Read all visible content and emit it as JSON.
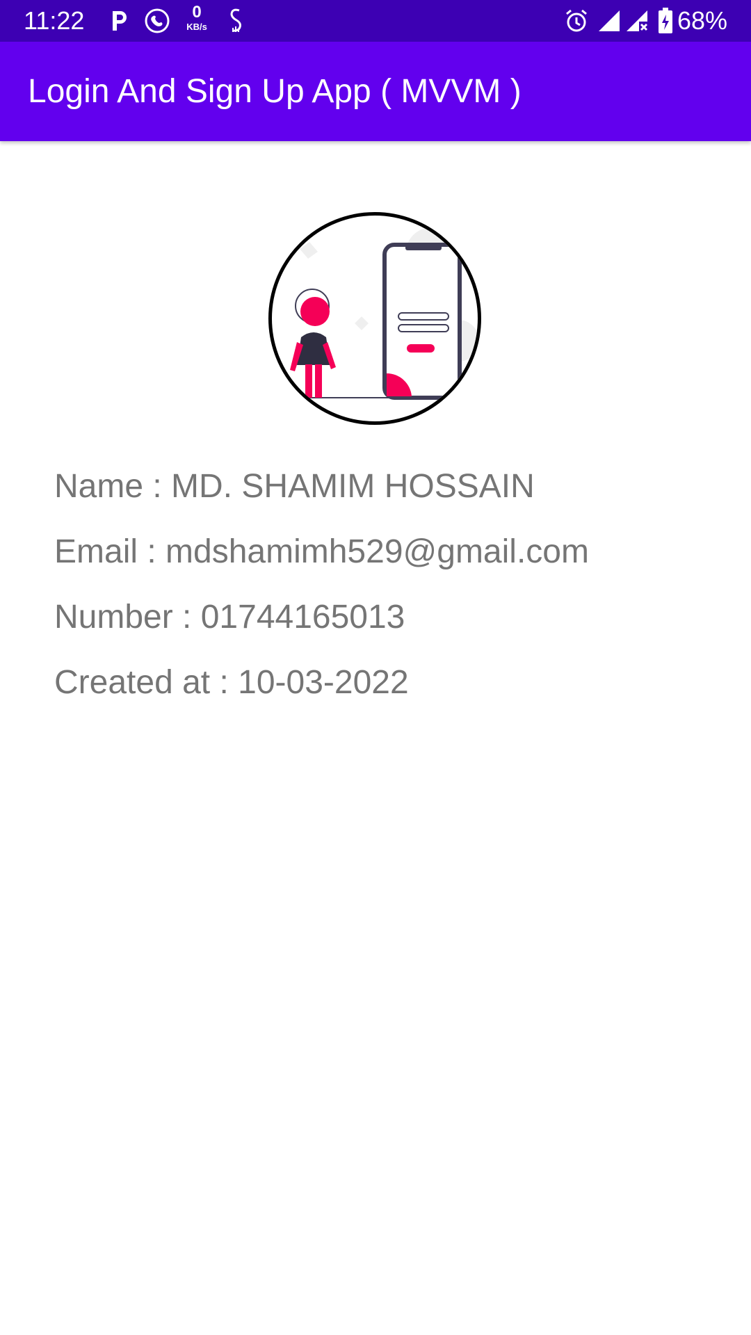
{
  "status_bar": {
    "time": "11:22",
    "net_speed_value": "0",
    "net_speed_unit": "KB/s",
    "battery": "68%",
    "icons": [
      "p-icon",
      "call-icon",
      "net-speed-icon",
      "s-icon",
      "alarm-icon",
      "signal-icon",
      "signal-x-icon",
      "battery-charging-icon"
    ]
  },
  "app_bar": {
    "title": "Login And Sign Up App ( MVVM )"
  },
  "colors": {
    "status_bar": "#3d00b3",
    "app_bar": "#6200ee",
    "accent": "#f50057",
    "text": "#757575"
  },
  "profile": {
    "name": "Name : MD. SHAMIM HOSSAIN",
    "email": "Email : mdshamimh529@gmail.com",
    "number": "Number : 01744165013",
    "created_at": "Created at : 10-03-2022"
  }
}
